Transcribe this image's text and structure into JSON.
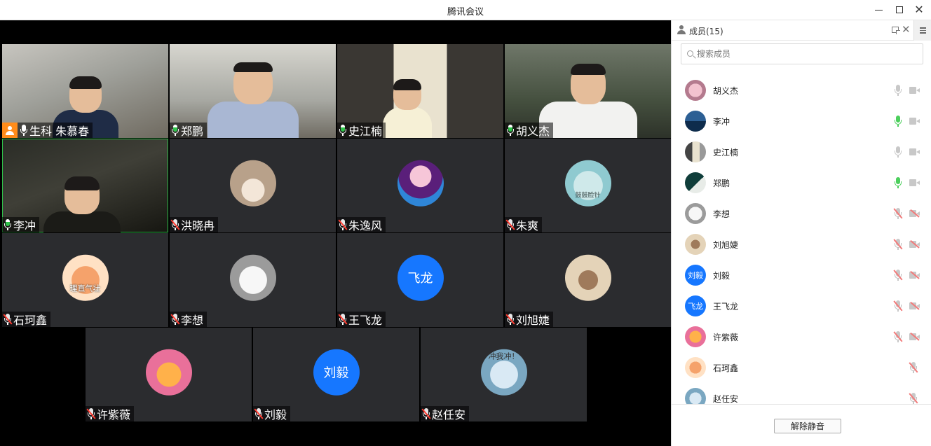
{
  "window": {
    "title": "腾讯会议"
  },
  "tiles": [
    {
      "name": "生科 朱慕春",
      "mic": "on",
      "host": true
    },
    {
      "name": "郑鹏",
      "mic": "on"
    },
    {
      "name": "史江楠",
      "mic": "on"
    },
    {
      "name": "胡义杰",
      "mic": "on"
    },
    {
      "name": "李冲",
      "mic": "on",
      "active": true
    },
    {
      "name": "洪晓冉",
      "mic": "muted"
    },
    {
      "name": "朱逸风",
      "mic": "muted"
    },
    {
      "name": "朱爽",
      "mic": "muted",
      "avatar_caption": "鼓鼓脸针"
    },
    {
      "name": "石珂鑫",
      "mic": "muted",
      "avatar_caption": "理直气壮"
    },
    {
      "name": "李想",
      "mic": "muted"
    },
    {
      "name": "王飞龙",
      "mic": "muted",
      "avatar_text": "飞龙"
    },
    {
      "name": "刘旭婕",
      "mic": "muted"
    },
    {
      "name": "许紫薇",
      "mic": "muted"
    },
    {
      "name": "刘毅",
      "mic": "muted",
      "avatar_text": "刘毅"
    },
    {
      "name": "赵任安",
      "mic": "muted",
      "avatar_caption": "冲我冲！"
    }
  ],
  "panel": {
    "title": "成员(15)",
    "search_placeholder": "搜索成员",
    "members": [
      {
        "name": "胡义杰",
        "mic": "off",
        "cam": "idle"
      },
      {
        "name": "李冲",
        "mic": "on",
        "cam": "idle"
      },
      {
        "name": "史江楠",
        "mic": "off",
        "cam": "idle"
      },
      {
        "name": "郑鹏",
        "mic": "on",
        "cam": "idle"
      },
      {
        "name": "李想",
        "mic": "muted",
        "cam": "off"
      },
      {
        "name": "刘旭婕",
        "mic": "muted",
        "cam": "off"
      },
      {
        "name": "刘毅",
        "mic": "muted",
        "cam": "off",
        "avatar_text": "刘毅"
      },
      {
        "name": "王飞龙",
        "mic": "muted",
        "cam": "off",
        "avatar_text": "飞龙"
      },
      {
        "name": "许紫薇",
        "mic": "muted",
        "cam": "off"
      },
      {
        "name": "石珂鑫",
        "mic": "muted"
      },
      {
        "name": "赵任安",
        "mic": "muted"
      }
    ],
    "unmute_label": "解除静音"
  },
  "colors": {
    "accent": "#1677ff",
    "active_border": "#2fc34a",
    "host": "#ff8c1a",
    "stage_bg": "#000000",
    "tile_bg": "#2b2c2f"
  }
}
